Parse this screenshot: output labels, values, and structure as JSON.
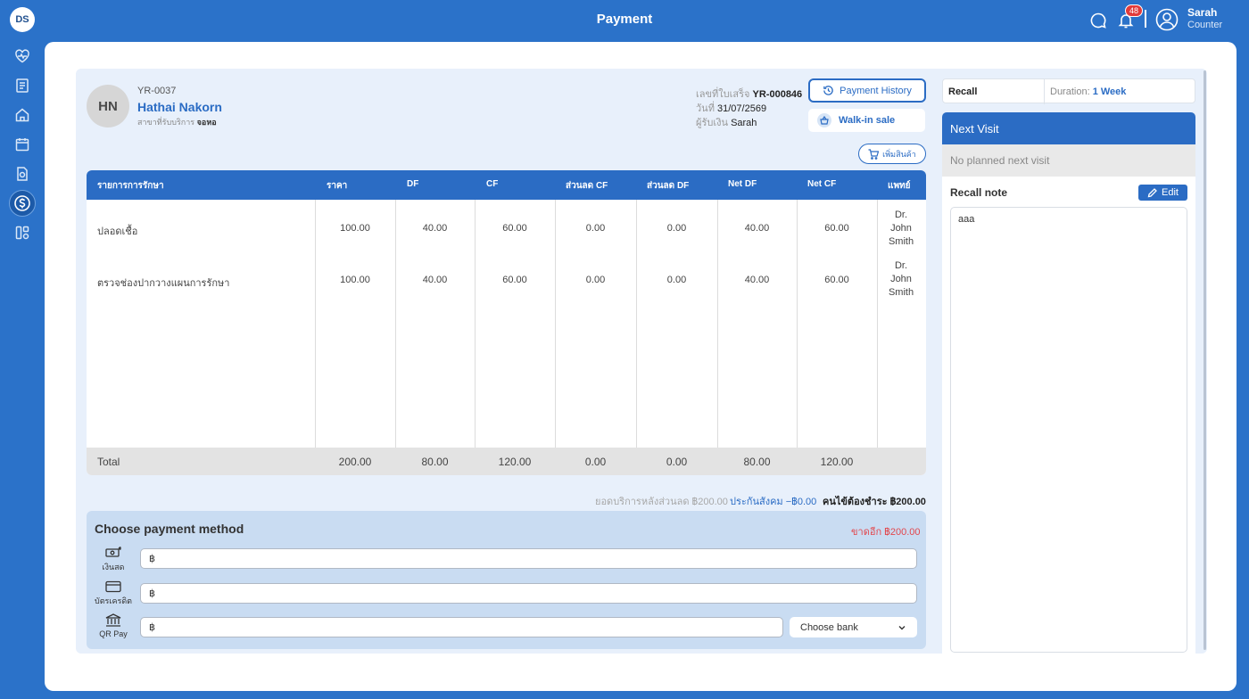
{
  "app": {
    "logo_text": "DS",
    "title": "Payment",
    "notification_count": "48",
    "user_name": "Sarah",
    "user_role": "Counter"
  },
  "patient": {
    "initials": "HN",
    "id": "YR-0037",
    "name": "Hathai Nakorn",
    "branch_label": "สาขาที่รับบริการ",
    "branch": "จอหอ"
  },
  "receipt": {
    "number_label": "เลขที่ใบเสร็จ",
    "number": "YR-000846",
    "date_label": "วันที่",
    "date": "31/07/2569",
    "cashier_label": "ผู้รับเงิน",
    "cashier": "Sarah"
  },
  "buttons": {
    "payment_history": "Payment History",
    "walk_in": "Walk-in sale",
    "add_product": "เพิ่มสินค้า",
    "edit": "Edit"
  },
  "table": {
    "headers": [
      "รายการการรักษา",
      "ราคา",
      "DF",
      "CF",
      "ส่วนลด CF",
      "ส่วนลด DF",
      "Net DF",
      "Net CF",
      "แพทย์"
    ],
    "rows": [
      {
        "item": "ปลอดเชื้อ",
        "price": "100.00",
        "df": "40.00",
        "cf": "60.00",
        "disc_cf": "0.00",
        "disc_df": "0.00",
        "net_df": "40.00",
        "net_cf": "60.00",
        "doctor": [
          "Dr.",
          "John",
          "Smith"
        ]
      },
      {
        "item": "ตรวจช่องปากวางแผนการรักษา",
        "price": "100.00",
        "df": "40.00",
        "cf": "60.00",
        "disc_cf": "0.00",
        "disc_df": "0.00",
        "net_df": "40.00",
        "net_cf": "60.00",
        "doctor": [
          "Dr.",
          "John",
          "Smith"
        ]
      }
    ],
    "total": {
      "label": "Total",
      "price": "200.00",
      "df": "80.00",
      "cf": "120.00",
      "disc_cf": "0.00",
      "disc_df": "0.00",
      "net_df": "80.00",
      "net_cf": "120.00"
    }
  },
  "summary": {
    "after_discount": "ยอดบริการหลังส่วนลด ฿200.00",
    "insurance": "ประกันสังคม −฿0.00",
    "patient_pays": "คนไข้ต้องชำระ ฿200.00"
  },
  "payment": {
    "title": "Choose payment method",
    "remaining": "ขาดอีก ฿200.00",
    "currency": "฿",
    "methods": [
      {
        "label": "เงินสด",
        "icon": "cash-icon",
        "value": ""
      },
      {
        "label": "บัตรเครดิต",
        "icon": "credit-card-icon",
        "value": ""
      },
      {
        "label": "QR Pay",
        "icon": "bank-icon",
        "value": ""
      }
    ],
    "bank_placeholder": "Choose bank"
  },
  "recall": {
    "label": "Recall",
    "duration_label": "Duration:",
    "duration": "1 Week",
    "next_visit_title": "Next Visit",
    "next_visit_value": "No planned next visit",
    "note_title": "Recall note",
    "note_text": "aaa"
  },
  "colors": {
    "brand": "#2b72c9",
    "header_blue": "#2b6cc4",
    "alert": "#e2474d"
  }
}
